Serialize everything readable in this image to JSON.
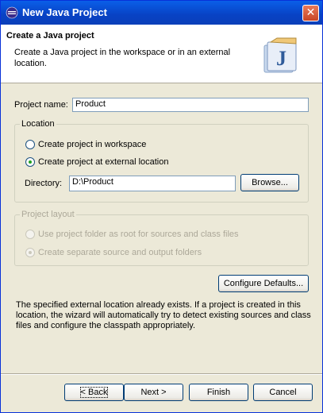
{
  "window": {
    "title": "New Java Project",
    "close_label": "✕"
  },
  "banner": {
    "title": "Create a Java project",
    "description": "Create a Java project in the workspace or in an external location.",
    "icon": "java-project-icon"
  },
  "project_name": {
    "label": "Project name:",
    "value": "Product"
  },
  "location": {
    "legend": "Location",
    "option_workspace": "Create project in workspace",
    "option_external": "Create project at external location",
    "selected": "external",
    "directory_label": "Directory:",
    "directory_value": "D:\\Product",
    "browse_label": "Browse..."
  },
  "project_layout": {
    "legend": "Project layout",
    "option_root": "Use project folder as root for sources and class files",
    "option_separate": "Create separate source and output folders",
    "selected": "separate",
    "enabled": false
  },
  "configure_defaults_label": "Configure Defaults...",
  "message": "The specified external location already exists. If a project is created in this location, the wizard will automatically try to detect existing sources and class files and configure the classpath appropriately.",
  "buttons": {
    "back": "< Back",
    "next": "Next >",
    "finish": "Finish",
    "cancel": "Cancel"
  }
}
